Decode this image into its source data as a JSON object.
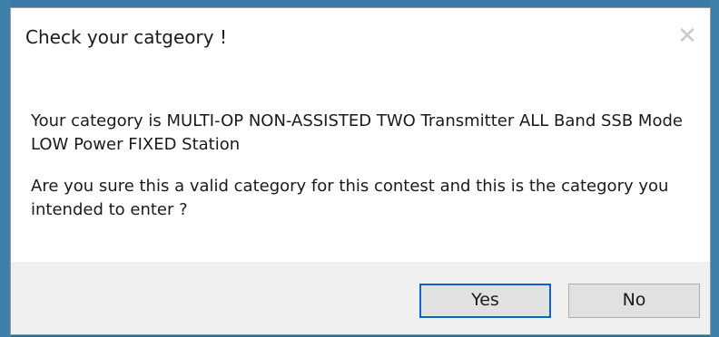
{
  "dialog": {
    "title": "Check your catgeory !",
    "close_glyph": "✕",
    "message_line1": "Your category is MULTI-OP NON-ASSISTED TWO Transmitter ALL Band SSB Mode LOW Power FIXED Station",
    "message_line2": "Are you sure this a valid category for this contest and this is the category you intended to enter ?",
    "buttons": {
      "yes": "Yes",
      "no": "No"
    }
  }
}
